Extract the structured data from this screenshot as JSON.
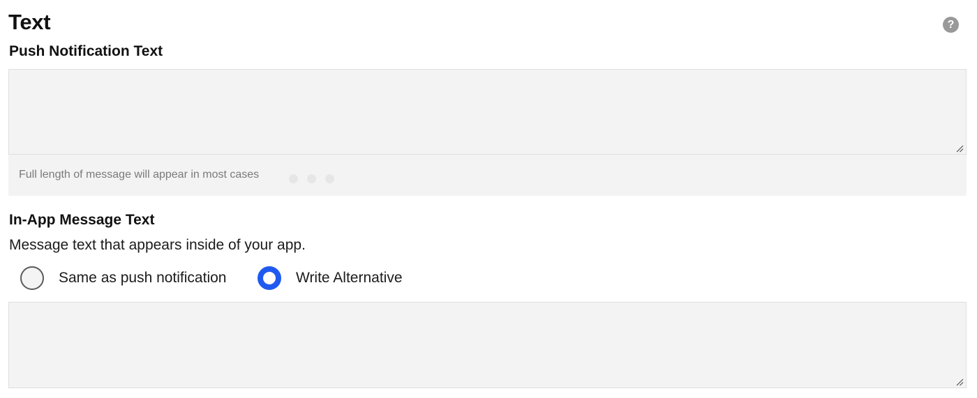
{
  "section": {
    "title": "Text",
    "help_icon": "question-circle-icon"
  },
  "push_notification": {
    "label": "Push Notification Text",
    "value": "",
    "hint": "Full length of message will appear in most cases"
  },
  "in_app": {
    "label": "In-App Message Text",
    "description": "Message text that appears inside of your app.",
    "options": [
      {
        "label": "Same as push notification",
        "selected": false
      },
      {
        "label": "Write Alternative",
        "selected": true
      }
    ],
    "value": ""
  },
  "colors": {
    "accent": "#1f5af0",
    "field_background": "#f3f3f3",
    "help_icon": "#999999"
  }
}
